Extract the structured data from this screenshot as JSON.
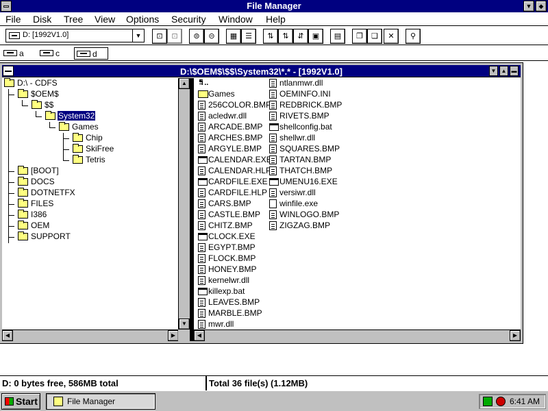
{
  "window": {
    "title": "File Manager",
    "min_glyph": "▼",
    "restore_glyph": "◆"
  },
  "menu": [
    "File",
    "Disk",
    "Tree",
    "View",
    "Options",
    "Security",
    "Window",
    "Help"
  ],
  "toolbar": {
    "drive_select_value": "D: [1992V1.0]",
    "dropdown_glyph": "▼",
    "delete_glyph": "✕"
  },
  "drives": [
    {
      "label": "a"
    },
    {
      "label": "c"
    },
    {
      "label": "d",
      "selected": true
    }
  ],
  "child": {
    "title": "D:\\$OEM$\\$$\\System32\\*.* - [1992V1.0]",
    "min_glyph": "▼",
    "max_glyph": "▲",
    "restore_glyph": "▬"
  },
  "tree": [
    {
      "label": "D:\\ - CDFS"
    },
    {
      "label": "$OEM$"
    },
    {
      "label": "$$"
    },
    {
      "label": "System32",
      "selected": true
    },
    {
      "label": "Games"
    },
    {
      "label": "Chip"
    },
    {
      "label": "SkiFree"
    },
    {
      "label": "Tetris"
    },
    {
      "label": "[BOOT]"
    },
    {
      "label": "DOCS"
    },
    {
      "label": "DOTNETFX"
    },
    {
      "label": "FILES"
    },
    {
      "label": "I386"
    },
    {
      "label": "OEM"
    },
    {
      "label": "SUPPORT"
    }
  ],
  "files_col1": [
    {
      "name": "",
      "icon": "up-icon",
      "glyph": "↰.."
    },
    {
      "name": "Games",
      "icon": "folder-icon"
    },
    {
      "name": "256COLOR.BMP",
      "icon": "document-icon"
    },
    {
      "name": "acledwr.dll",
      "icon": "document-icon"
    },
    {
      "name": "ARCADE.BMP",
      "icon": "document-icon"
    },
    {
      "name": "ARCHES.BMP",
      "icon": "document-icon"
    },
    {
      "name": "ARGYLE.BMP",
      "icon": "document-icon"
    },
    {
      "name": "CALENDAR.EXE",
      "icon": "program-icon"
    },
    {
      "name": "CALENDAR.HLP",
      "icon": "document-icon"
    },
    {
      "name": "CARDFILE.EXE",
      "icon": "program-icon"
    },
    {
      "name": "CARDFILE.HLP",
      "icon": "document-icon"
    },
    {
      "name": "CARS.BMP",
      "icon": "document-icon"
    },
    {
      "name": "CASTLE.BMP",
      "icon": "document-icon"
    },
    {
      "name": "CHITZ.BMP",
      "icon": "document-icon"
    },
    {
      "name": "CLOCK.EXE",
      "icon": "program-icon"
    },
    {
      "name": "EGYPT.BMP",
      "icon": "document-icon"
    },
    {
      "name": "FLOCK.BMP",
      "icon": "document-icon"
    },
    {
      "name": "HONEY.BMP",
      "icon": "document-icon"
    },
    {
      "name": "kernelwr.dll",
      "icon": "document-icon"
    },
    {
      "name": "killexp.bat",
      "icon": "program-icon"
    },
    {
      "name": "LEAVES.BMP",
      "icon": "document-icon"
    },
    {
      "name": "MARBLE.BMP",
      "icon": "document-icon"
    },
    {
      "name": "mwr.dll",
      "icon": "document-icon"
    }
  ],
  "files_col2": [
    {
      "name": "ntlanmwr.dll",
      "icon": "document-icon"
    },
    {
      "name": "OEMINFO.INI",
      "icon": "document-icon"
    },
    {
      "name": "REDBRICK.BMP",
      "icon": "document-icon"
    },
    {
      "name": "RIVETS.BMP",
      "icon": "document-icon"
    },
    {
      "name": "shellconfig.bat",
      "icon": "program-icon"
    },
    {
      "name": "shellwr.dll",
      "icon": "document-icon"
    },
    {
      "name": "SQUARES.BMP",
      "icon": "document-icon"
    },
    {
      "name": "TARTAN.BMP",
      "icon": "document-icon"
    },
    {
      "name": "THATCH.BMP",
      "icon": "document-icon"
    },
    {
      "name": "UMENU16.EXE",
      "icon": "program-icon"
    },
    {
      "name": "versiwr.dll",
      "icon": "document-icon"
    },
    {
      "name": "winfile.exe",
      "icon": "file-icon"
    },
    {
      "name": "WINLOGO.BMP",
      "icon": "document-icon"
    },
    {
      "name": "ZIGZAG.BMP",
      "icon": "document-icon"
    }
  ],
  "status": {
    "left": "D: 0 bytes free,  586MB total",
    "right": "Total 36 file(s) (1.12MB)"
  },
  "taskbar": {
    "start_label": "Start",
    "task_label": "File Manager",
    "clock": "6:41 AM"
  },
  "colors": {
    "titlebar": "#000080",
    "selection": "#000080",
    "chrome": "#c0c0c0"
  }
}
